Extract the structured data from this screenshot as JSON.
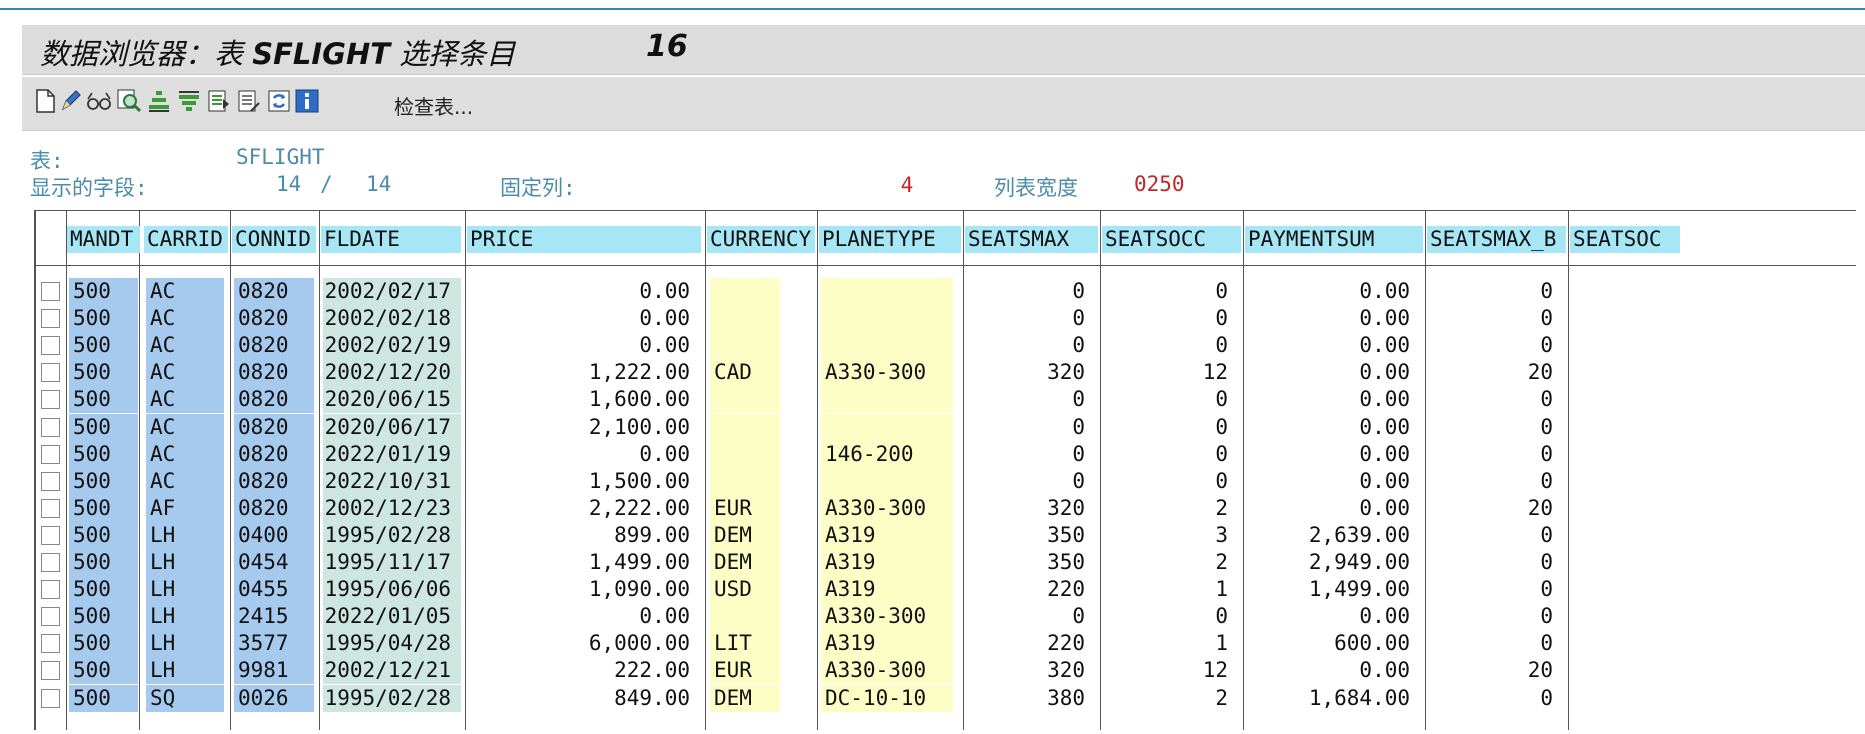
{
  "window": {
    "title_prefix": "数据浏览器：表 ",
    "title_table": "SFLIGHT",
    "title_suffix": " 选择条目",
    "title_count": "16"
  },
  "toolbar": {
    "buttons": [
      {
        "name": "new-page-icon"
      },
      {
        "name": "pencil-icon"
      },
      {
        "name": "glasses-icon"
      },
      {
        "name": "magnifier-icon"
      },
      {
        "name": "sort-ascending-icon"
      },
      {
        "name": "filter-icon"
      },
      {
        "name": "select-layout-icon"
      },
      {
        "name": "change-layout-icon"
      },
      {
        "name": "refresh-icon"
      },
      {
        "name": "info-icon"
      }
    ],
    "check_table_label": "检查表..."
  },
  "info": {
    "table_label": "表:",
    "table_value": "SFLIGHT",
    "fields_label": "显示的字段:",
    "fields_shown": "14",
    "fields_sep": "/",
    "fields_total": "14",
    "fixed_cols_label": "固定列:",
    "fixed_cols_value": "4",
    "list_width_label": "列表宽度",
    "list_width_value": "0250"
  },
  "colors": {
    "key_column": "#a6c9ee",
    "date_column": "#cde6df",
    "header": "#a7e6f5",
    "optional_field": "#fdfdc6",
    "accent_red": "#c0282a"
  },
  "table": {
    "columns": [
      "MANDT",
      "CARRID",
      "CONNID",
      "FLDATE",
      "PRICE",
      "CURRENCY",
      "PLANETYPE",
      "SEATSMAX",
      "SEATSOCC",
      "PAYMENTSUM",
      "SEATSMAX_B",
      "SEATSOC"
    ],
    "rows": [
      [
        "500",
        "AC",
        "0820",
        "2002/02/17",
        "0.00",
        "",
        "",
        "0",
        "0",
        "0.00",
        "0"
      ],
      [
        "500",
        "AC",
        "0820",
        "2002/02/18",
        "0.00",
        "",
        "",
        "0",
        "0",
        "0.00",
        "0"
      ],
      [
        "500",
        "AC",
        "0820",
        "2002/02/19",
        "0.00",
        "",
        "",
        "0",
        "0",
        "0.00",
        "0"
      ],
      [
        "500",
        "AC",
        "0820",
        "2002/12/20",
        "1,222.00",
        "CAD",
        "A330-300",
        "320",
        "12",
        "0.00",
        "20"
      ],
      [
        "500",
        "AC",
        "0820",
        "2020/06/15",
        "1,600.00",
        "",
        "",
        "0",
        "0",
        "0.00",
        "0"
      ],
      [
        "500",
        "AC",
        "0820",
        "2020/06/17",
        "2,100.00",
        "",
        "",
        "0",
        "0",
        "0.00",
        "0"
      ],
      [
        "500",
        "AC",
        "0820",
        "2022/01/19",
        "0.00",
        "",
        "146-200",
        "0",
        "0",
        "0.00",
        "0"
      ],
      [
        "500",
        "AC",
        "0820",
        "2022/10/31",
        "1,500.00",
        "",
        "",
        "0",
        "0",
        "0.00",
        "0"
      ],
      [
        "500",
        "AF",
        "0820",
        "2002/12/23",
        "2,222.00",
        "EUR",
        "A330-300",
        "320",
        "2",
        "0.00",
        "20"
      ],
      [
        "500",
        "LH",
        "0400",
        "1995/02/28",
        "899.00",
        "DEM",
        "A319",
        "350",
        "3",
        "2,639.00",
        "0"
      ],
      [
        "500",
        "LH",
        "0454",
        "1995/11/17",
        "1,499.00",
        "DEM",
        "A319",
        "350",
        "2",
        "2,949.00",
        "0"
      ],
      [
        "500",
        "LH",
        "0455",
        "1995/06/06",
        "1,090.00",
        "USD",
        "A319",
        "220",
        "1",
        "1,499.00",
        "0"
      ],
      [
        "500",
        "LH",
        "2415",
        "2022/01/05",
        "0.00",
        "",
        "A330-300",
        "0",
        "0",
        "0.00",
        "0"
      ],
      [
        "500",
        "LH",
        "3577",
        "1995/04/28",
        "6,000.00",
        "LIT",
        "A319",
        "220",
        "1",
        "600.00",
        "0"
      ],
      [
        "500",
        "LH",
        "9981",
        "2002/12/21",
        "222.00",
        "EUR",
        "A330-300",
        "320",
        "12",
        "0.00",
        "20"
      ],
      [
        "500",
        "SQ",
        "0026",
        "1995/02/28",
        "849.00",
        "DEM",
        "DC-10-10",
        "380",
        "2",
        "1,684.00",
        "0"
      ]
    ]
  }
}
